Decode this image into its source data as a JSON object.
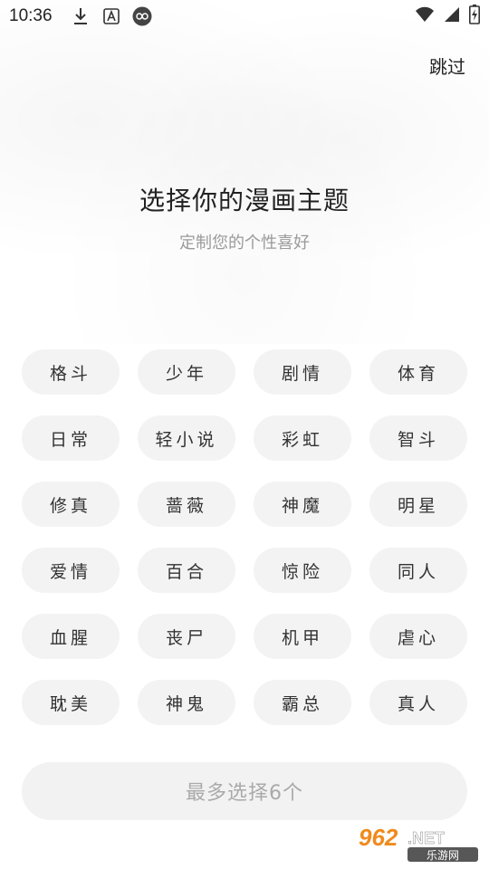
{
  "status_bar": {
    "time": "10:36",
    "icons_left": [
      "download-icon",
      "font-a-icon",
      "infinity-icon"
    ],
    "icons_right": [
      "wifi-icon",
      "signal-icon",
      "battery-charging-icon"
    ]
  },
  "header": {
    "skip_label": "跳过"
  },
  "intro": {
    "title": "选择你的漫画主题",
    "subtitle": "定制您的个性喜好"
  },
  "tags": [
    "格斗",
    "少年",
    "剧情",
    "体育",
    "日常",
    "轻小说",
    "彩虹",
    "智斗",
    "修真",
    "蔷薇",
    "神魔",
    "明星",
    "爱情",
    "百合",
    "惊险",
    "同人",
    "血腥",
    "丧尸",
    "机甲",
    "虐心",
    "耽美",
    "神鬼",
    "霸总",
    "真人"
  ],
  "footer": {
    "button_label": "最多选择6个"
  },
  "watermark": {
    "brand": "962",
    "suffix": ".NET",
    "caption": "乐游网"
  },
  "colors": {
    "tag_bg": "#f3f3f3",
    "button_bg": "#f2f2f2",
    "muted_text": "#aaaaaa",
    "watermark_orange": "#f08a1c"
  }
}
